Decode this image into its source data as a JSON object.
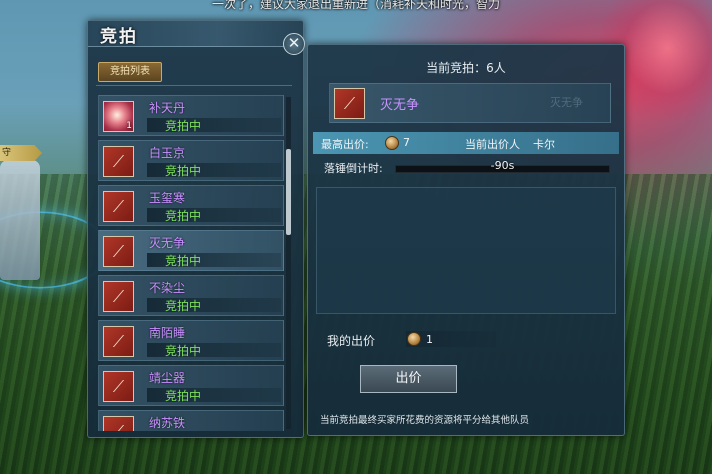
{
  "banner": {
    "text": "一次了，建议大家退出重新进（消耗补天和时光，智力"
  },
  "npc_tag": {
    "label": "守"
  },
  "auction_window": {
    "title": "竞拍",
    "list_tab_label": "竞拍列表",
    "close_symbol": "✕",
    "list_items": [
      {
        "name": "补天丹",
        "status": "竞拍中",
        "count": "1",
        "icon": "pill-icon"
      },
      {
        "name": "白玉京",
        "status": "竞拍中",
        "icon": "weapon-icon"
      },
      {
        "name": "玉玺寒",
        "status": "竞拍中",
        "icon": "weapon-icon"
      },
      {
        "name": "灭无争",
        "status": "竞拍中",
        "icon": "weapon-icon"
      },
      {
        "name": "不染尘",
        "status": "竞拍中",
        "icon": "weapon-icon"
      },
      {
        "name": "南陌睡",
        "status": "竞拍中",
        "icon": "weapon-icon"
      },
      {
        "name": "靖尘器",
        "status": "竞拍中",
        "icon": "weapon-icon"
      },
      {
        "name": "纳苏铁",
        "status": "",
        "icon": "weapon-icon"
      }
    ],
    "scroll_position": 0.16
  },
  "detail": {
    "bidders_text": "当前竞拍：6人",
    "current_item_name": "灭无争",
    "faded_text": "灭无争",
    "highest_bid_label": "最高出价:",
    "highest_bid_value": "7",
    "current_bidder_label": "当前出价人",
    "current_bidder_name": "卡尔",
    "countdown_label": "落锤倒计时:",
    "countdown_value": "-90s",
    "my_bid_label": "我的出价",
    "my_bid_value": "1",
    "bid_button_label": "出价",
    "note": "当前竞拍最终买家所花费的资源将平分给其他队员"
  },
  "colors": {
    "item_name": "#c991ff",
    "status": "#7fe05a",
    "highlight_row": "#50a0be"
  }
}
